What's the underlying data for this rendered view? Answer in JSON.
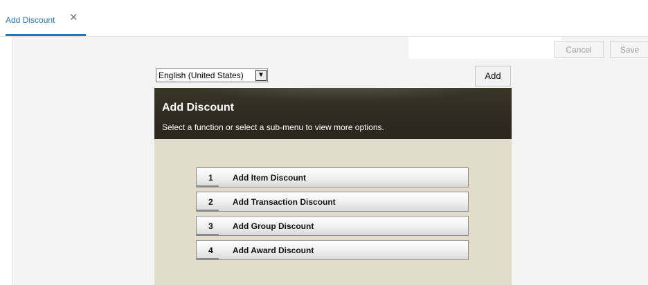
{
  "tab": {
    "label": "Add Discount",
    "close_glyph": "✕"
  },
  "toolbar": {
    "cancel_label": "Cancel",
    "save_label": "Save"
  },
  "language": {
    "selected": "English (United States)",
    "chevron": "▼"
  },
  "add_button": "Add",
  "panel": {
    "title": "Add Discount",
    "subtitle": "Select a function or select a sub-menu to view more options."
  },
  "menu": [
    {
      "num": "1",
      "label": "Add Item Discount"
    },
    {
      "num": "2",
      "label": "Add Transaction Discount"
    },
    {
      "num": "3",
      "label": "Add Group Discount"
    },
    {
      "num": "4",
      "label": "Add Award Discount"
    }
  ],
  "colors": {
    "accent": "#2a73b8",
    "panel_header": "#2e2a20",
    "panel_bg": "#e2dccd"
  }
}
